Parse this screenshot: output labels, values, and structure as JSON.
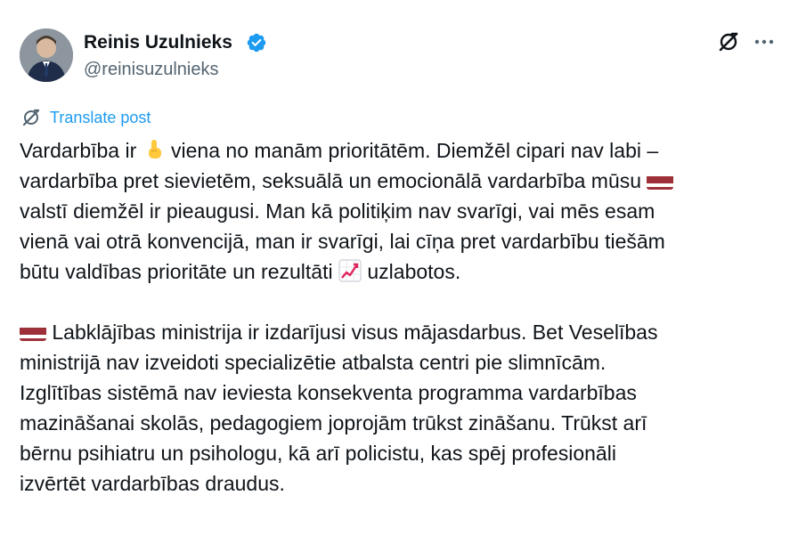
{
  "author": {
    "name": "Reinis Uzulnieks",
    "handle": "@reinisuzulnieks",
    "verified": true
  },
  "actions": {
    "grok_icon": "grok-icon",
    "more_icon": "more-icon"
  },
  "translate": {
    "label": "Translate post"
  },
  "post": {
    "p1": {
      "l1a": "Vardarbība ir ",
      "l1b": " viena no manām prioritātēm. Diemžēl cipari nav labi –",
      "l2a": "vardarbība pret sievietēm, seksuālā un emocionālā vardarbība mūsu ",
      "l3": "valstī diemžēl ir pieaugusi. Man kā politiķim nav svarīgi, vai mēs esam",
      "l4": "vienā vai otrā konvencijā, man ir svarīgi, lai cīņa pret vardarbību tiešām",
      "l5a": "būtu valdības prioritāte un rezultāti ",
      "l5b": " uzlabotos."
    },
    "p2": {
      "l1b": " Labklājības ministrija ir izdarījusi visus mājasdarbus. Bet Veselības",
      "l2": "ministrijā nav izveidoti specializētie atbalsta centri pie slimnīcām.",
      "l3": "Izglītības sistēmā nav ieviesta konsekventa programma vardarbības",
      "l4": "mazināšanai skolās, pedagogiem joprojām trūkst zināšanu. Trūkst arī",
      "l5": "bērnu psihiatru un psihologu, kā arī policistu, kas spēj profesionāli",
      "l6": "izvērtēt vardarbības draudus."
    }
  },
  "colors": {
    "link": "#1d9bf0",
    "text": "#0f1419",
    "muted": "#536471",
    "latvia_flag": "#9e3039"
  }
}
